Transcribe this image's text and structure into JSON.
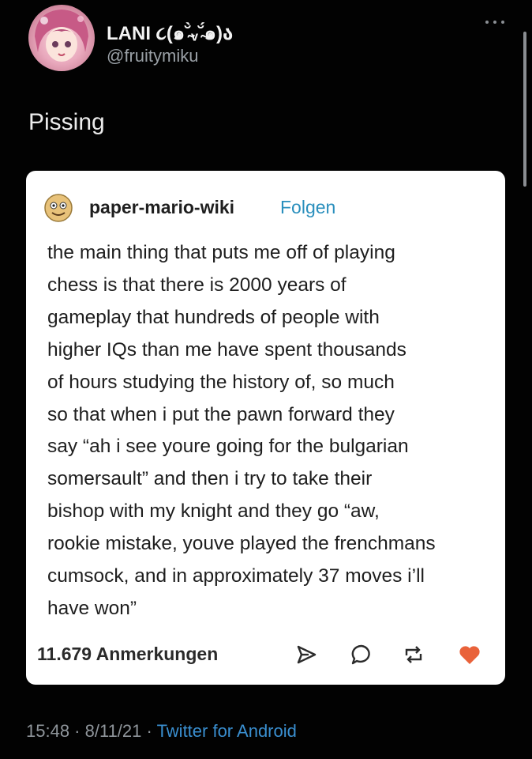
{
  "tweet": {
    "display_name": "LANI ૮(๑˘̴̀ᵥ˘̴́๑)ა",
    "handle": "@fruitymiku",
    "text": "Pissing",
    "timestamp": {
      "time": "15:48",
      "separator1": " · ",
      "date": "8/11/21",
      "separator2": " · ",
      "source": "Twitter for Android"
    }
  },
  "tumblr_post": {
    "blog_name": "paper-mario-wiki",
    "follow_label": "Folgen",
    "body_lines": [
      "the main thing that puts me off of playing",
      "chess is that there is 2000 years of",
      "gameplay that hundreds of people with",
      "higher IQs than me have spent thousands",
      "of hours studying the history of, so much",
      "so that when i put the pawn forward they",
      "say “ah i see youre going for the bulgarian",
      "somersault” and then i try to take their",
      "bishop with my knight and they go “aw,",
      "rookie mistake, youve played the frenchmans",
      "cumsock, and in approximately 37 moves i’ll",
      "have won”"
    ],
    "notes": "11.679 Anmerkungen",
    "icons": [
      "share-icon",
      "reply-icon",
      "reblog-icon",
      "heart-icon"
    ]
  },
  "colors": {
    "background": "#020202",
    "card": "#ffffff",
    "tumblr_link": "#2a8fbd",
    "twitter_link": "#3a8fd0",
    "heart": "#e9623a"
  }
}
